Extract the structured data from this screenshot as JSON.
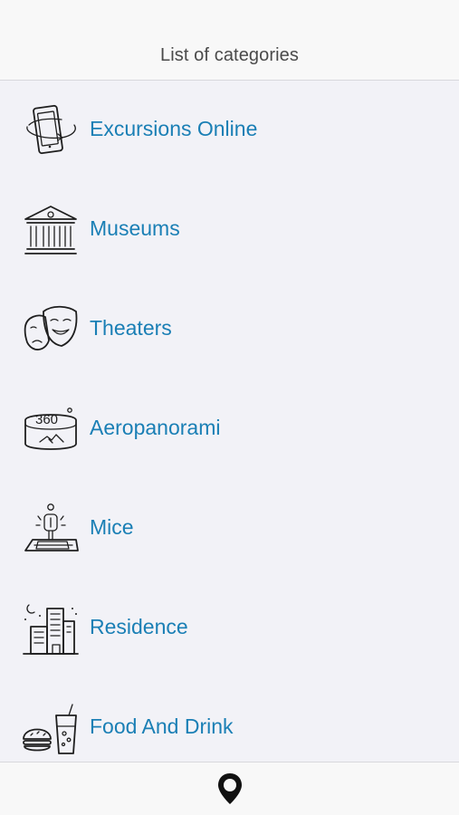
{
  "header": {
    "title": "List of categories"
  },
  "categories": [
    {
      "label": "Excursions Online",
      "icon": "tablet-rotate-icon"
    },
    {
      "label": "Museums",
      "icon": "museum-icon"
    },
    {
      "label": "Theaters",
      "icon": "theater-masks-icon"
    },
    {
      "label": "Aeropanorami",
      "icon": "panorama-360-icon"
    },
    {
      "label": "Mice",
      "icon": "presentation-person-icon"
    },
    {
      "label": "Residence",
      "icon": "city-buildings-icon"
    },
    {
      "label": "Food And Drink",
      "icon": "burger-drink-icon"
    }
  ],
  "icons": {
    "panorama_text": "360"
  },
  "tab_bar": {
    "map_icon": "map-pin-icon"
  },
  "colors": {
    "link": "#1a7fb5",
    "background": "#f2f2f7",
    "bar": "#f8f8f8"
  }
}
